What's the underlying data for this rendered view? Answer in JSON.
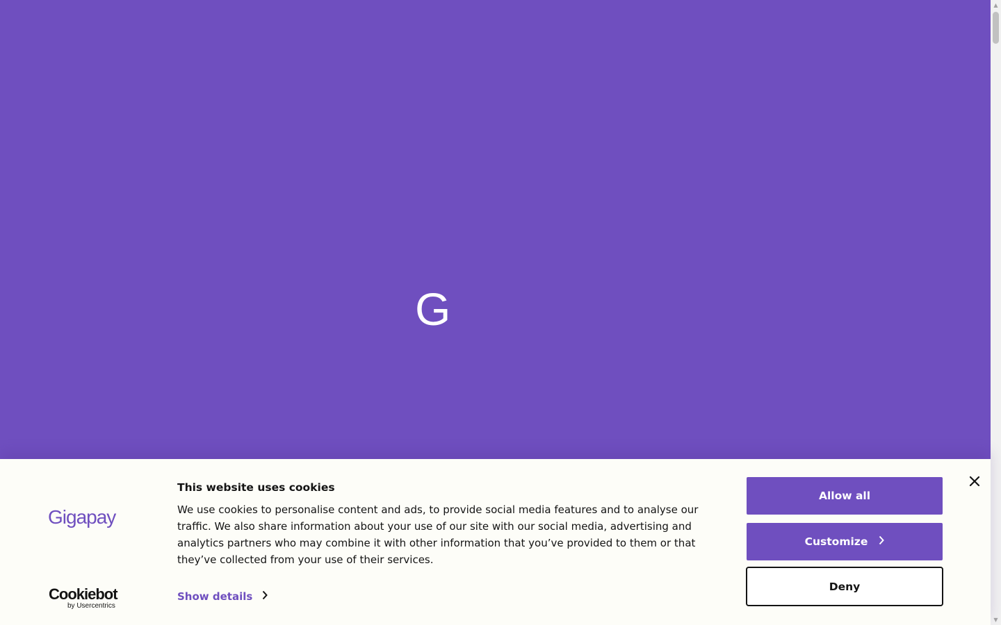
{
  "hero": {
    "letter": "G",
    "background": "#6f4fbf"
  },
  "cookie_banner": {
    "brand_logo": "Gigapay",
    "title": "This website uses cookies",
    "body": "We use cookies to personalise content and ads, to provide social media features and to analyse our traffic. We also share information about your use of our site with our social media, advertising and analytics partners who may combine it with other information that you’ve provided to them or that they’ve collected from your use of their services.",
    "show_details_label": "Show details",
    "provider": {
      "name": "Cookiebot",
      "sub": "by Usercentrics"
    },
    "buttons": {
      "allow_all": "Allow all",
      "customize": "Customize",
      "deny": "Deny"
    },
    "close_icon": "close-icon",
    "accent_color": "#6f4fbf",
    "background": "#fdfdf8"
  }
}
